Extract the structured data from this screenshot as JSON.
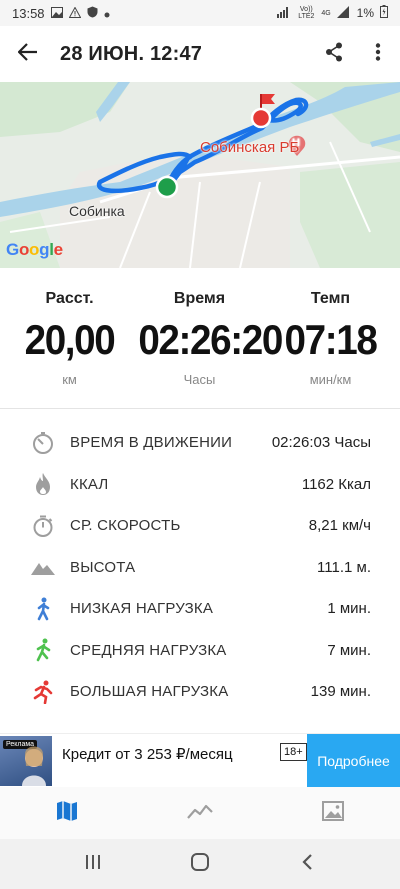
{
  "status_bar": {
    "time": "13:58",
    "icons_left": [
      "gallery-icon",
      "warning-icon",
      "shield-icon",
      "dot-icon"
    ],
    "network": "Vo)) LTE2",
    "network_type": "4G",
    "battery_percent": "1%"
  },
  "app_bar": {
    "title": "28 ИЮН. 12:47",
    "back_icon": "arrow-back-icon",
    "share_icon": "share-icon",
    "more_icon": "more-vert-icon"
  },
  "map": {
    "town_label": "Собинка",
    "hospital_label": "Собинская РБ",
    "hospital_marker": "H",
    "attribution": "Google",
    "route_color": "#1a73e8",
    "start_color": "#1e9e4a",
    "end_color": "#e53935"
  },
  "summary": {
    "distance": {
      "label": "Расст.",
      "value": "20,00",
      "unit": "км"
    },
    "time": {
      "label": "Время",
      "value": "02:26:20",
      "unit": "Часы"
    },
    "pace": {
      "label": "Темп",
      "value": "07:18",
      "unit": "мин/км"
    }
  },
  "stats": [
    {
      "icon": "timer-icon",
      "label": "ВРЕМЯ В ДВИЖЕНИИ",
      "value": "02:26:03 Часы"
    },
    {
      "icon": "flame-icon",
      "label": "ККАЛ",
      "value": "1162 Ккал"
    },
    {
      "icon": "stopwatch-icon",
      "label": "СР. СКОРОСТЬ",
      "value": "8,21 км/ч"
    },
    {
      "icon": "mountain-icon",
      "label": "ВЫСОТА",
      "value": "111.1 м."
    },
    {
      "icon": "walker-icon",
      "label": "НИЗКАЯ НАГРУЗКА",
      "value": "1 мин."
    },
    {
      "icon": "walker-icon",
      "label": "СРЕДНЯЯ НАГРУЗКА",
      "value": "7 мин."
    },
    {
      "icon": "runner-icon",
      "label": "БОЛЬШАЯ НАГРУЗКА",
      "value": "139 мин."
    }
  ],
  "ad": {
    "badge": "Реклама",
    "text": "Кредит от 3 253 ₽/месяц",
    "age": "18+",
    "button": "Подробнее"
  },
  "bottom_nav": [
    "map-icon",
    "chart-line-icon",
    "image-icon"
  ],
  "system_nav": [
    "recent-apps-icon",
    "home-icon",
    "back-icon"
  ]
}
